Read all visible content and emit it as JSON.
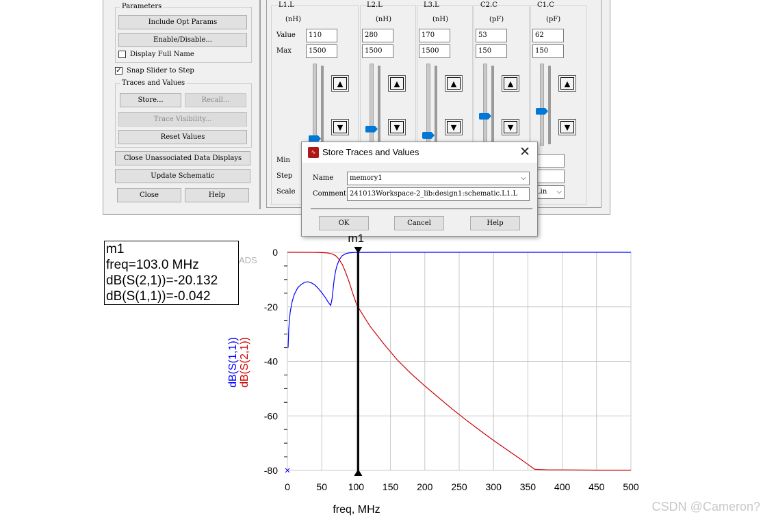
{
  "tuning_panel": {
    "parameters_group": "Parameters",
    "include_opt_params": "Include Opt Params",
    "enable_disable": "Enable/Disable...",
    "display_full_name": "Display Full Name",
    "display_full_name_checked": false,
    "snap_slider": "Snap Slider to Step",
    "snap_slider_checked": true,
    "traces_group": "Traces and Values",
    "store": "Store...",
    "recall": "Recall...",
    "trace_visibility": "Trace Visibility...",
    "reset_values": "Reset Values",
    "close_unassociated": "Close Unassociated Data Displays",
    "update_schematic": "Update Schematic",
    "close": "Close",
    "help": "Help",
    "row_labels": {
      "value": "Value",
      "max": "Max",
      "min": "Min",
      "step": "Step",
      "scale": "Scale"
    },
    "scale_value": "Lin",
    "columns": [
      {
        "name": "L1.L",
        "unit": "(nH)",
        "value": "110",
        "max": "1500",
        "slider_fraction": 0.07
      },
      {
        "name": "L2.L",
        "unit": "(nH)",
        "value": "280",
        "max": "1500",
        "slider_fraction": 0.19
      },
      {
        "name": "L3.L",
        "unit": "(nH)",
        "value": "170",
        "max": "1500",
        "slider_fraction": 0.11
      },
      {
        "name": "C2.C",
        "unit": "(pF)",
        "value": "53",
        "max": "150",
        "slider_fraction": 0.35
      },
      {
        "name": "C1.C",
        "unit": "(pF)",
        "value": "62",
        "max": "150",
        "slider_fraction": 0.41
      }
    ]
  },
  "dialog": {
    "title": "Store Traces and Values",
    "name_label": "Name",
    "name_value": "memory1",
    "comment_label": "Comment",
    "comment_value": "241013Workspace-2_lib:design1:schematic.L1.L",
    "ok": "OK",
    "cancel": "Cancel",
    "help": "Help"
  },
  "marker_readout": {
    "name": "m1",
    "freq": "freq=103.0 MHz",
    "s21": "dB(S(2,1))=-20.132",
    "s11": "dB(S(1,1))=-0.042"
  },
  "plot_marker_label": "m1",
  "ads_text": "ADS",
  "watermark": "CSDN @Cameron?",
  "chart_data": {
    "type": "line",
    "xlabel": "freq, MHz",
    "ylabel_parts": [
      "dB(S(1,1))",
      "dB(S(2,1))"
    ],
    "xlim": [
      0,
      500
    ],
    "ylim": [
      -80,
      0
    ],
    "xticks": [
      0,
      50,
      100,
      150,
      200,
      250,
      300,
      350,
      400,
      450,
      500
    ],
    "yticks": [
      0,
      -20,
      -40,
      -60,
      -80
    ],
    "grid": true,
    "marker_x": 103,
    "series": [
      {
        "name": "dB(S(1,1))",
        "color": "#0000ff",
        "x": [
          1,
          2,
          4,
          7,
          10,
          15,
          20,
          25,
          30,
          35,
          40,
          45,
          50,
          55,
          60,
          63,
          65,
          68,
          70,
          72,
          75,
          78,
          80,
          85,
          90,
          95,
          100,
          103,
          110,
          150,
          200,
          300,
          400,
          500
        ],
        "y": [
          -35,
          -28,
          -22,
          -18,
          -15.5,
          -13,
          -11.8,
          -11.0,
          -10.8,
          -11.2,
          -12.0,
          -13.3,
          -14.8,
          -16.5,
          -18.5,
          -19.5,
          -17,
          -10,
          -7,
          -5,
          -3,
          -1.8,
          -1.2,
          -0.5,
          -0.2,
          -0.1,
          -0.05,
          -0.042,
          -0.02,
          -0.01,
          -0.005,
          -0.002,
          -0.001,
          -0.001
        ]
      },
      {
        "name": "dB(S(2,1))",
        "color": "#cc0000",
        "x": [
          0,
          20,
          40,
          50,
          60,
          65,
          70,
          75,
          80,
          85,
          90,
          95,
          100,
          103,
          110,
          120,
          140,
          160,
          180,
          200,
          220,
          240,
          260,
          280,
          300,
          320,
          340,
          360,
          380,
          400,
          450,
          500
        ],
        "y": [
          0,
          0,
          -0.05,
          -0.1,
          -0.3,
          -0.6,
          -1.2,
          -2.5,
          -4.5,
          -7.5,
          -11,
          -15,
          -18.6,
          -20.132,
          -23,
          -27,
          -33.5,
          -39.5,
          -44.5,
          -49,
          -53.3,
          -57.5,
          -61.5,
          -65.3,
          -69,
          -72.5,
          -76,
          -79.6,
          -79.8,
          -79.8,
          -79.9,
          -79.9
        ]
      }
    ]
  }
}
